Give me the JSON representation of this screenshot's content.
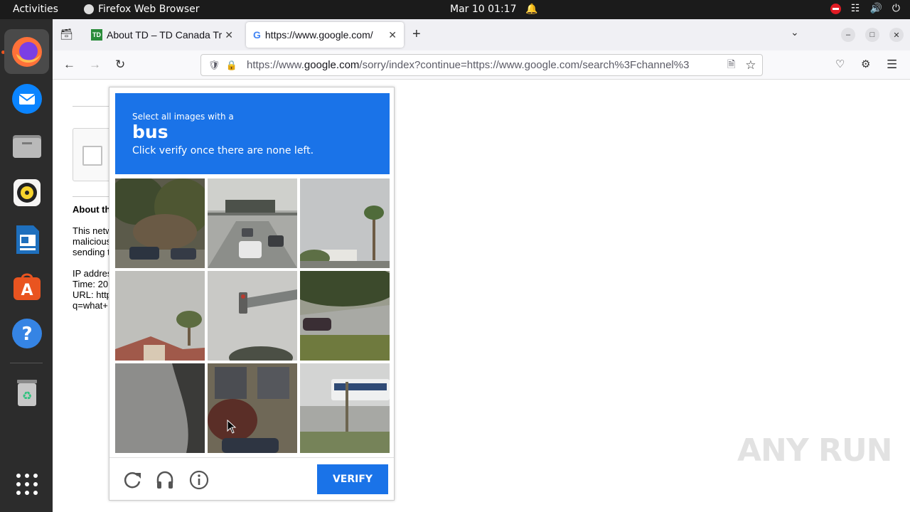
{
  "topbar": {
    "activities": "Activities",
    "app_name": "Firefox Web Browser",
    "datetime": "Mar 10  01:17"
  },
  "dock": {
    "items": [
      {
        "name": "firefox",
        "color": "#ff7139"
      },
      {
        "name": "thunderbird",
        "color": "#0a84ff"
      },
      {
        "name": "files",
        "color": "#9c9c9c"
      },
      {
        "name": "rhythmbox",
        "color": "#f6d32d"
      },
      {
        "name": "libreoffice-writer",
        "color": "#1e6fbd"
      },
      {
        "name": "app-center",
        "color": "#e95420"
      },
      {
        "name": "help",
        "color": "#3584e4"
      },
      {
        "name": "trash",
        "color": "#b5b5b5"
      }
    ]
  },
  "tabs": [
    {
      "title": "About TD – TD Canada Tr",
      "favicon": "TD"
    },
    {
      "title": "https://www.google.com/",
      "favicon": "G"
    }
  ],
  "urlbar": {
    "prefix": "https://www.",
    "domain": "google.com",
    "rest": "/sorry/index?continue=https://www.google.com/search%3Fchannel%3"
  },
  "page": {
    "about_heading": "About th",
    "line1": "This netw",
    "line2": "malicious",
    "line3": "sending t",
    "ip_line": "IP addres",
    "time_line": "Time: 20",
    "url_line": "URL: http",
    "q_line": "q=what+"
  },
  "captcha": {
    "prompt": "Select all images with a",
    "keyword": "bus",
    "instruction": "Click verify once there are none left.",
    "verify_label": "VERIFY",
    "tiles": [
      {
        "subject": "trees and cars on hill"
      },
      {
        "subject": "highway with cars"
      },
      {
        "subject": "palm tree"
      },
      {
        "subject": "palm tree and roof"
      },
      {
        "subject": "traffic light"
      },
      {
        "subject": "car on road"
      },
      {
        "subject": "dark shadow"
      },
      {
        "subject": "building with tree"
      },
      {
        "subject": "bus on street"
      }
    ]
  },
  "watermark": "ANY RUN",
  "colors": {
    "accent": "#1a73e8",
    "topbar": "#1b1b1b",
    "dock": "#2c2c2c"
  }
}
